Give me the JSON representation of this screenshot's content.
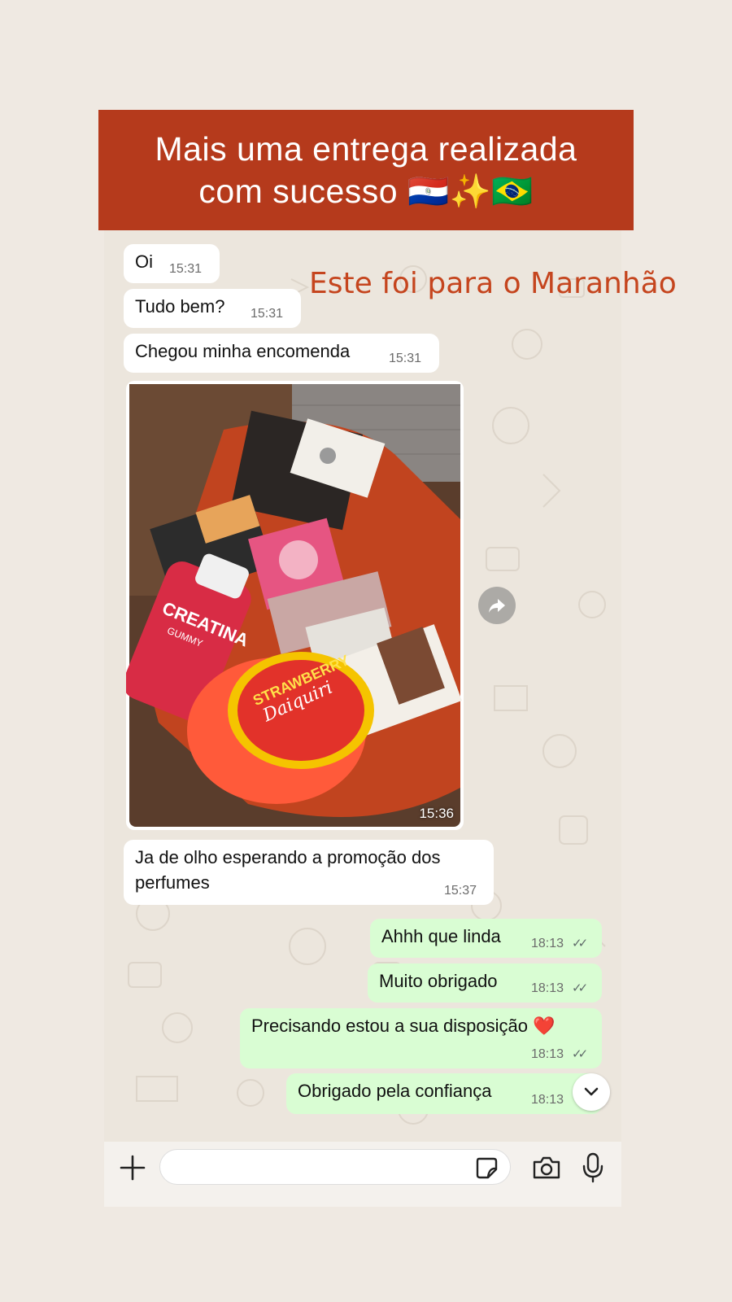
{
  "banner": {
    "line1": "Mais uma entrega realizada",
    "line2": "com sucesso 🇵🇾✨🇧🇷"
  },
  "overlay_caption": "Este foi para o Maranhão",
  "messages": [
    {
      "text": "Oi",
      "time": "15:31",
      "direction": "in"
    },
    {
      "text": "Tudo bem?",
      "time": "15:31",
      "direction": "in"
    },
    {
      "text": "Chegou minha encomenda",
      "time": "15:31",
      "direction": "in"
    },
    {
      "text": "Ja de olho esperando a promoção dos",
      "text2": "perfumes",
      "time": "15:37",
      "direction": "in"
    },
    {
      "text": "Ahhh que linda",
      "time": "18:13",
      "direction": "out"
    },
    {
      "text": "Muito obrigado",
      "time": "18:13",
      "direction": "out"
    },
    {
      "text": "Precisando estou a sua disposição ❤️",
      "time": "18:13",
      "direction": "out"
    },
    {
      "text": "Obrigado pela confiança",
      "time": "18:13",
      "direction": "out"
    }
  ],
  "photo": {
    "time": "15:36",
    "labels": {
      "creatina": "CREATINA",
      "gummy": "GUMMY",
      "strawberry": "STRAWBERRY",
      "daiquiri": "Daiquiri"
    }
  },
  "icons": {
    "read": "double-check-icon",
    "forward": "forward-arrow-icon",
    "scroll": "chevron-down-icon",
    "attach": "plus-icon",
    "sticker": "sticker-icon",
    "camera": "camera-icon",
    "mic": "microphone-icon"
  },
  "colors": {
    "banner": "#b53a1c",
    "caption": "#c5451e",
    "incoming": "#ffffff",
    "outgoing": "#d9fdd3"
  },
  "input": {
    "placeholder": ""
  }
}
